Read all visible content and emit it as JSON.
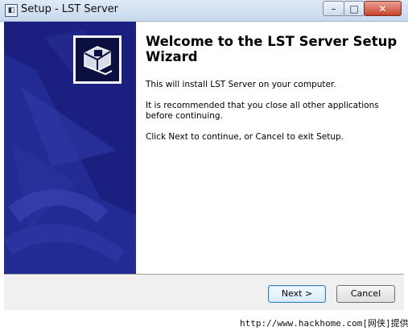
{
  "window": {
    "title": "Setup - LST Server",
    "minimize_glyph": "–",
    "maximize_glyph": "□",
    "close_glyph": "✕"
  },
  "content": {
    "heading": "Welcome to the LST Server Setup Wizard",
    "paragraph_1": "This will install LST Server on your computer.",
    "paragraph_2": "It is recommended that you close all other applications before continuing.",
    "paragraph_3": "Click Next to continue, or Cancel to exit Setup."
  },
  "buttons": {
    "next": "Next >",
    "cancel": "Cancel"
  },
  "watermark": "http://www.hackhome.com[网侠]提供",
  "icons": {
    "app": "setup-app-icon",
    "logo": "computer-install-icon"
  },
  "colors": {
    "side_panel": "#1b1f80",
    "footer": "#f0f0f0",
    "title_bar": "#c8d9ee",
    "close_button": "#c7452f"
  }
}
